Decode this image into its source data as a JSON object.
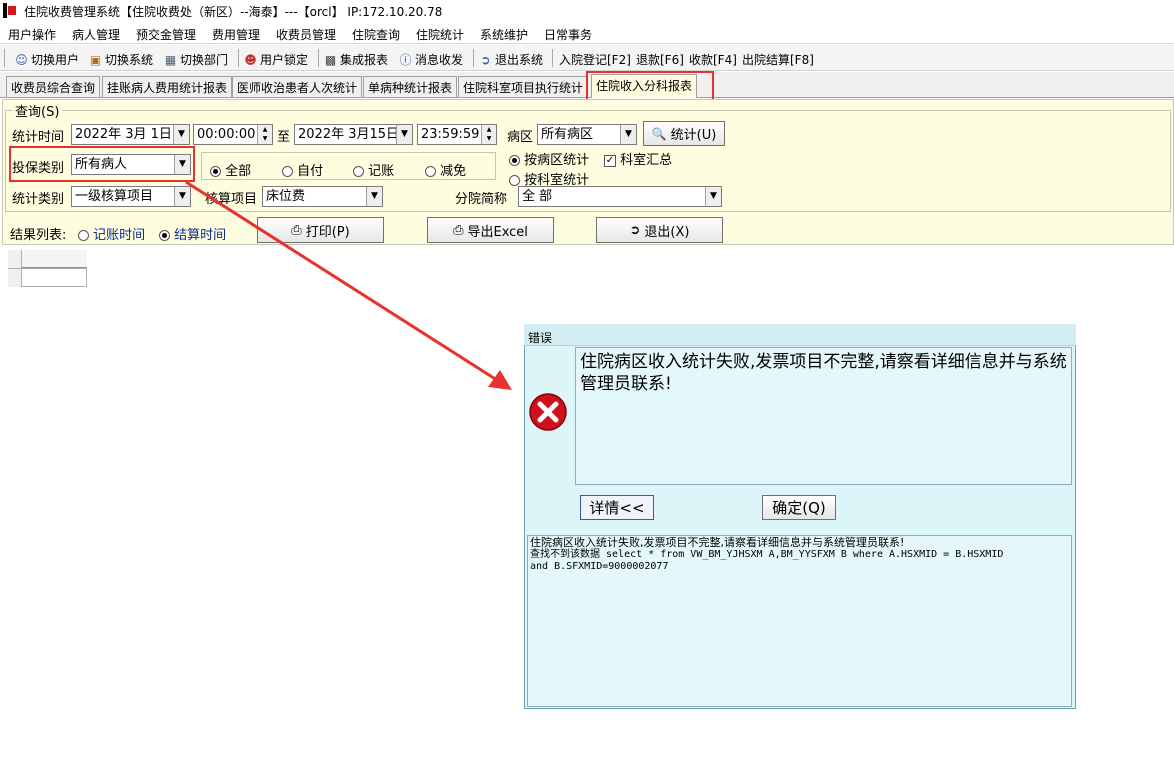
{
  "window": {
    "title": "住院收费管理系统【住院收费处（新区）--海泰】---【orcl】 IP:172.10.20.78"
  },
  "menu": {
    "items": [
      "用户操作",
      "病人管理",
      "预交金管理",
      "费用管理",
      "收费员管理",
      "住院查询",
      "住院统计",
      "系统维护",
      "日常事务"
    ]
  },
  "toolbar": {
    "switch_user": "切换用户",
    "switch_system": "切换系统",
    "switch_dept": "切换部门",
    "lock_user": "用户锁定",
    "integrated_report": "集成报表",
    "messages": "消息收发",
    "exit_system": "退出系统",
    "admission": "入院登记[F2]",
    "refund": "退款[F6]",
    "charge": "收款[F4]",
    "discharge": "出院结算[F8]"
  },
  "tabs": [
    {
      "label": "收费员综合查询",
      "active": false
    },
    {
      "label": "挂账病人费用统计报表",
      "active": false
    },
    {
      "label": "医师收治患者人次统计",
      "active": false
    },
    {
      "label": "单病种统计报表",
      "active": false
    },
    {
      "label": "住院科室项目执行统计",
      "active": false
    },
    {
      "label": "住院收入分科报表",
      "active": true
    }
  ],
  "query": {
    "group_label": "查询(S)",
    "stat_time_label": "统计时间",
    "start_date": "2022年 3月 1日",
    "start_time": "00:00:00",
    "to_label": "至",
    "end_date": "2022年 3月15日",
    "end_time": "23:59:59",
    "ward_label": "病区",
    "ward_value": "所有病区",
    "stat_button": "统计(U)",
    "insurance_label": "投保类别",
    "insurance_value": "所有病人",
    "pay_options": [
      "全部",
      "自付",
      "记账",
      "减免"
    ],
    "pay_selected": 0,
    "by_ward_label": "按病区统计",
    "dept_summary_label": "科室汇总",
    "by_dept_label": "按科室统计",
    "stat_type_label": "统计类别",
    "stat_type_value": "一级核算项目",
    "account_item_label": "核算项目",
    "account_item_value": "床位费",
    "branch_label": "分院简称",
    "branch_value": "全 部",
    "result_label": "结果列表:",
    "result_options": [
      "记账时间",
      "结算时间"
    ],
    "result_selected": 1,
    "print_button": "打印(P)",
    "export_button": "导出Excel",
    "exit_button": "退出(X)"
  },
  "dialog": {
    "title": "错误",
    "message": "住院病区收入统计失败,发票项目不完整,请察看详细信息并与系统管理员联系!",
    "details_button": "详情<<",
    "ok_button": "确定(Q)",
    "details_line1": "住院病区收入统计失败,发票项目不完整,请察看详细信息并与系统管理员联系!",
    "details_line2": "查找不到该数据 select  *  from  VW_BM_YJHSXM A,BM_YYSFXM B  where   A.HSXMID = B.HSXMID",
    "details_line3": "and B.SFXMID=9000002077"
  },
  "colors": {
    "panel_bg": "#fffde0",
    "dialog_bg": "#dcf5f8",
    "annotation_red": "#e8322e",
    "error_icon": "#d0101c"
  }
}
